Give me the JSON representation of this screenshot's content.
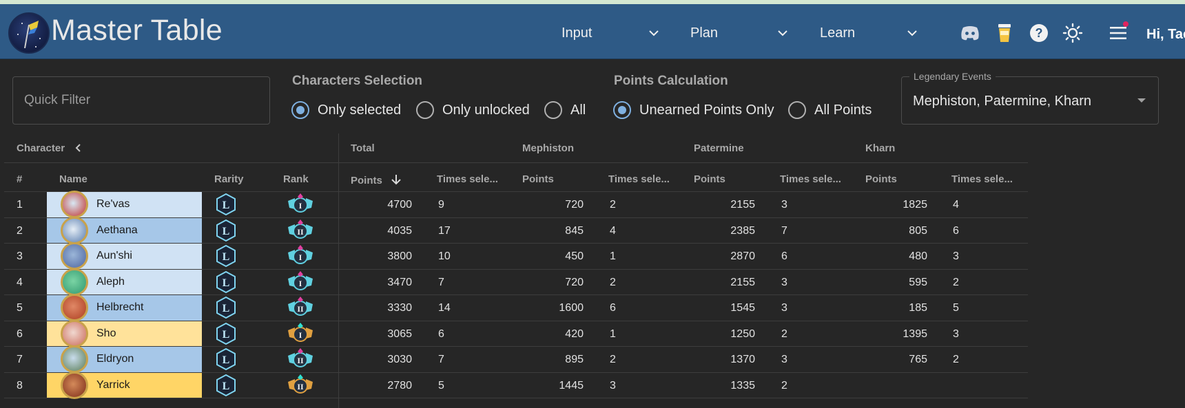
{
  "app": {
    "title": "Master Table"
  },
  "nav": [
    {
      "label": "Input"
    },
    {
      "label": "Plan"
    },
    {
      "label": "Learn"
    }
  ],
  "header_icons": [
    "discord-icon",
    "coffee-cup-icon",
    "help-icon",
    "sun-icon",
    "menu-icon"
  ],
  "user": {
    "greeting": "Hi, Tac"
  },
  "filter": {
    "placeholder": "Quick Filter"
  },
  "characters_selection": {
    "label": "Characters Selection",
    "options": [
      "Only selected",
      "Only unlocked",
      "All"
    ],
    "selected": "Only selected"
  },
  "points_calculation": {
    "label": "Points Calculation",
    "options": [
      "Unearned Points Only",
      "All Points"
    ],
    "selected": "Unearned Points Only"
  },
  "legendary_events": {
    "label": "Legendary Events",
    "value": "Mephiston, Patermine, Kharn"
  },
  "table": {
    "group_headers": {
      "character": "Character",
      "total": "Total",
      "mephiston": "Mephiston",
      "patermine": "Patermine",
      "kharn": "Kharn"
    },
    "columns": {
      "index": "#",
      "name": "Name",
      "rarity": "Rarity",
      "rank": "Rank",
      "points": "Points",
      "times": "Times sele..."
    },
    "rows": [
      {
        "n": "1",
        "name": "Re'vas",
        "tier": "light",
        "rank": "I",
        "rank_color": "teal",
        "total_points": "4700",
        "total_times": "9",
        "meph_points": "720",
        "meph_times": "2",
        "pat_points": "2155",
        "pat_times": "3",
        "kharn_points": "1825",
        "kharn_times": "4"
      },
      {
        "n": "2",
        "name": "Aethana",
        "tier": "blue",
        "rank": "II",
        "rank_color": "teal",
        "total_points": "4035",
        "total_times": "17",
        "meph_points": "845",
        "meph_times": "4",
        "pat_points": "2385",
        "pat_times": "7",
        "kharn_points": "805",
        "kharn_times": "6"
      },
      {
        "n": "3",
        "name": "Aun'shi",
        "tier": "light",
        "rank": "I",
        "rank_color": "teal",
        "total_points": "3800",
        "total_times": "10",
        "meph_points": "450",
        "meph_times": "1",
        "pat_points": "2870",
        "pat_times": "6",
        "kharn_points": "480",
        "kharn_times": "3"
      },
      {
        "n": "4",
        "name": "Aleph",
        "tier": "light",
        "rank": "I",
        "rank_color": "teal",
        "total_points": "3470",
        "total_times": "7",
        "meph_points": "720",
        "meph_times": "2",
        "pat_points": "2155",
        "pat_times": "3",
        "kharn_points": "595",
        "kharn_times": "2"
      },
      {
        "n": "5",
        "name": "Helbrecht",
        "tier": "blue",
        "rank": "II",
        "rank_color": "teal",
        "total_points": "3330",
        "total_times": "14",
        "meph_points": "1600",
        "meph_times": "6",
        "pat_points": "1545",
        "pat_times": "3",
        "kharn_points": "185",
        "kharn_times": "5"
      },
      {
        "n": "6",
        "name": "Sho",
        "tier": "gold-light",
        "rank": "I",
        "rank_color": "gold",
        "total_points": "3065",
        "total_times": "6",
        "meph_points": "420",
        "meph_times": "1",
        "pat_points": "1250",
        "pat_times": "2",
        "kharn_points": "1395",
        "kharn_times": "3"
      },
      {
        "n": "7",
        "name": "Eldryon",
        "tier": "blue",
        "rank": "II",
        "rank_color": "teal",
        "total_points": "3030",
        "total_times": "7",
        "meph_points": "895",
        "meph_times": "2",
        "pat_points": "1370",
        "pat_times": "3",
        "kharn_points": "765",
        "kharn_times": "2"
      },
      {
        "n": "8",
        "name": "Yarrick",
        "tier": "gold",
        "rank": "II",
        "rank_color": "gold",
        "total_points": "2780",
        "total_times": "5",
        "meph_points": "1445",
        "meph_times": "3",
        "pat_points": "1335",
        "pat_times": "2",
        "kharn_points": "",
        "kharn_times": ""
      }
    ]
  },
  "colors": {
    "appbar": "#2e5a86",
    "background": "#262626",
    "accent": "#7fb0e0",
    "row_light": "#d0e2f4",
    "row_blue": "#a6c7e8",
    "row_gold_light": "#ffe29a",
    "row_gold": "#ffd566"
  }
}
